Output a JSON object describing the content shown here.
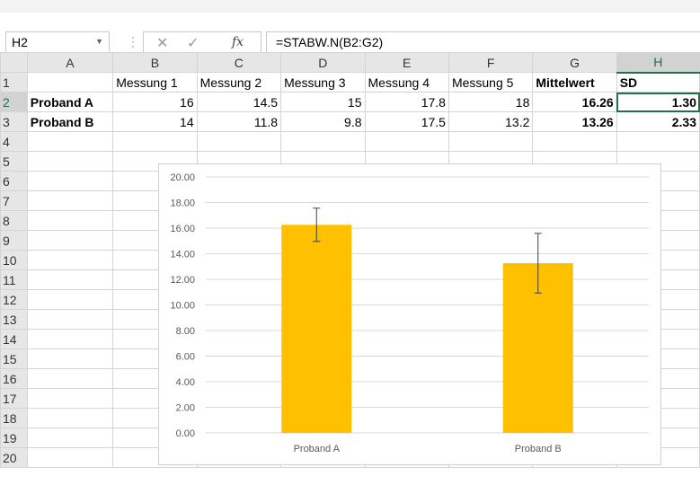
{
  "formula_bar": {
    "name_box": "H2",
    "cancel_icon": "✕",
    "enter_icon": "✓",
    "fx_label": "fx",
    "formula": "=STABW.N(B2:G2)"
  },
  "sheet": {
    "columns": [
      "A",
      "B",
      "C",
      "D",
      "E",
      "F",
      "G",
      "H"
    ],
    "rows": [
      "1",
      "2",
      "3",
      "4",
      "5",
      "6",
      "7",
      "8",
      "9",
      "10",
      "11",
      "12",
      "13",
      "14",
      "15",
      "16",
      "17",
      "18",
      "19",
      "20"
    ],
    "header_row": [
      "",
      "Messung 1",
      "Messung 2",
      "Messung 3",
      "Messung 4",
      "Messung 5",
      "Mittelwert",
      "SD"
    ],
    "data_rows": [
      [
        "Proband A",
        "16",
        "14.5",
        "15",
        "17.8",
        "18",
        "16.26",
        "1.30"
      ],
      [
        "Proband B",
        "14",
        "11.8",
        "9.8",
        "17.5",
        "13.2",
        "13.26",
        "2.33"
      ]
    ],
    "active_cell": "H2",
    "accent_color": "#217346"
  },
  "chart_data": {
    "type": "bar",
    "categories": [
      "Proband A",
      "Proband B"
    ],
    "values": [
      16.26,
      13.26
    ],
    "error_bars": [
      1.3,
      2.33
    ],
    "ylim": [
      0,
      20
    ],
    "yticks": [
      "0.00",
      "2.00",
      "4.00",
      "6.00",
      "8.00",
      "10.00",
      "12.00",
      "14.00",
      "16.00",
      "18.00",
      "20.00"
    ],
    "bar_color": "#FFC000",
    "grid": true,
    "title": "",
    "xlabel": "",
    "ylabel": ""
  }
}
